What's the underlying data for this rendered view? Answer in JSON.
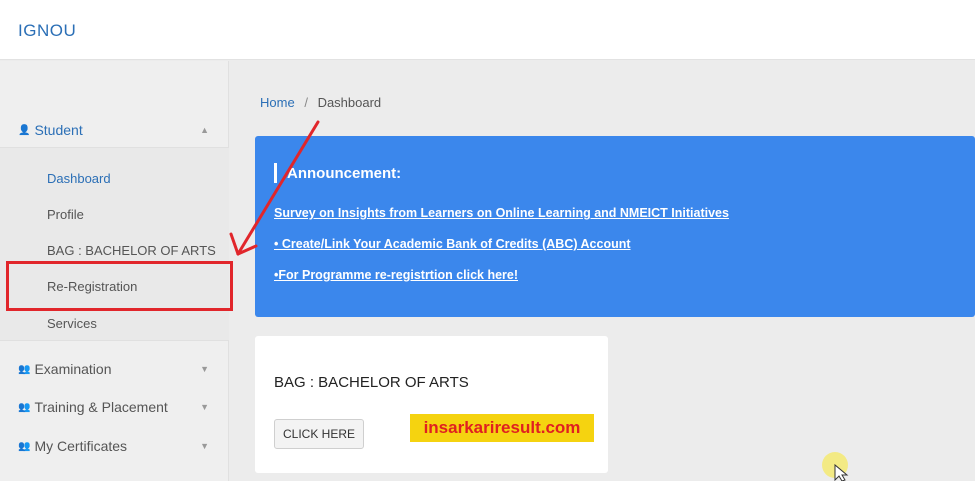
{
  "app": {
    "brand": "IGNOU"
  },
  "sidebar": {
    "student_label": "Student",
    "sub_items": [
      "Dashboard",
      "Profile",
      "BAG : BACHELOR OF ARTS",
      "Re-Registration",
      "Services"
    ],
    "sections": [
      "Examination",
      "Training & Placement",
      "My Certificates"
    ]
  },
  "breadcrumb": {
    "home": "Home",
    "separator": "/",
    "current": "Dashboard"
  },
  "announcement": {
    "title": "Announcement:",
    "links": [
      "Survey on Insights from Learners on Online Learning and NMEICT Initiatives",
      "• Create/Link Your Academic Bank of Credits (ABC) Account",
      "•For Programme re-registrtion click here!"
    ],
    "color": "#3b87ec"
  },
  "card": {
    "title": "BAG : BACHELOR OF ARTS",
    "button": "CLICK HERE"
  },
  "watermark": {
    "text": "insarkariresult.com"
  },
  "colors": {
    "accent": "#2b6fb6",
    "highlight": "#e1262b"
  }
}
